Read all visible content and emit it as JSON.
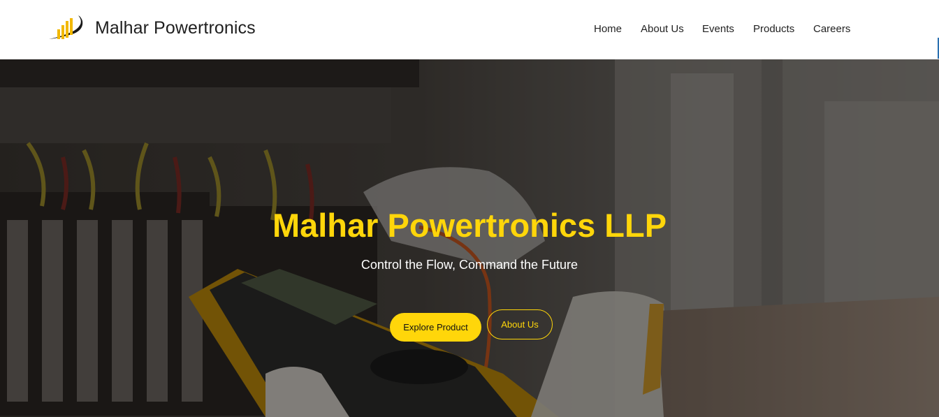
{
  "header": {
    "brand_name": "Malhar Powertronics",
    "logo_icon": "bars-swoosh-logo",
    "nav": [
      {
        "label": "Home"
      },
      {
        "label": "About Us"
      },
      {
        "label": "Events"
      },
      {
        "label": "Products"
      },
      {
        "label": "Careers"
      }
    ]
  },
  "hero": {
    "title": "Malhar Powertronics LLP",
    "subtitle": "Control the Flow, Command the Future",
    "primary_button": "Explore Product",
    "secondary_button": "About Us",
    "background": "technician-multimeter-electrical-panel-photo"
  },
  "colors": {
    "accent": "#ffd60a",
    "header_bg": "#ffffff",
    "nav_text": "#222222",
    "hero_overlay": "#000000"
  }
}
